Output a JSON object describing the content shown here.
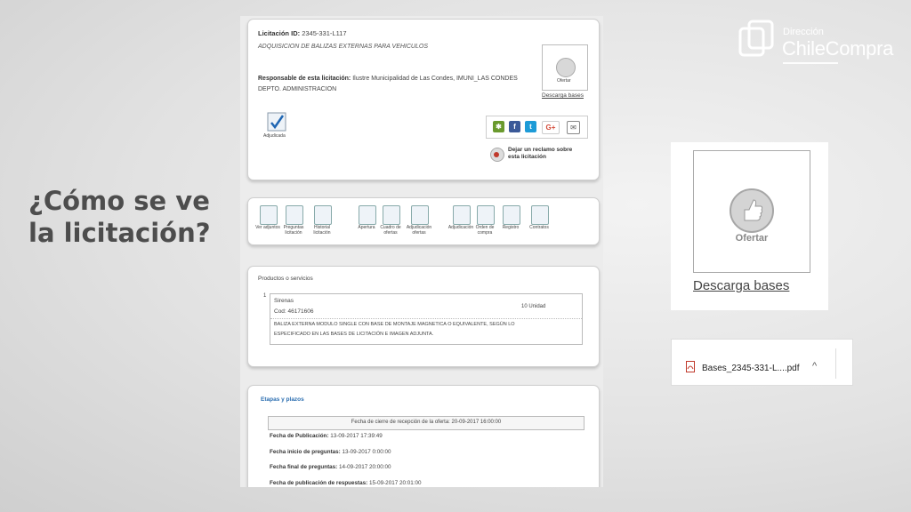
{
  "slide": {
    "title_line1": "¿Cómo se ve",
    "title_line2": "la licitación?"
  },
  "logo": {
    "direccion": "Dirección",
    "name": "ChileCompra"
  },
  "licitacion": {
    "id_label": "Licitación",
    "id_prefix": "ID:",
    "id_value": "2345-331-L117",
    "description": "ADQUISICION DE BALIZAS EXTERNAS PARA VEHICULOS",
    "responsable_label": "Responsable de esta licitación:",
    "responsable_value": "Ilustre Municipalidad de Las Condes, IMUNI_LAS CONDES",
    "depto": "DEPTO. ADMINISTRACION",
    "status_label": "Adjudicada",
    "ofertar_small_label": "Ofertar",
    "descarga_bases_small": "Descarga bases",
    "social": [
      "share",
      "f",
      "t",
      "G+",
      "mail"
    ],
    "reclamo_line1": "Dejar un reclamo sobre",
    "reclamo_line2": "esta licitación"
  },
  "actions": [
    {
      "icon": "ver-adjuntos-icon",
      "label": "Ver adjuntos"
    },
    {
      "icon": "preguntas-icon",
      "label": "Preguntas licitación"
    },
    {
      "icon": "historial-icon",
      "label": "Historial licitación"
    },
    {
      "icon": "apertura-icon",
      "label": "Apertura"
    },
    {
      "icon": "cuadro-ofertas-icon",
      "label": "Cuadro de ofertas"
    },
    {
      "icon": "adjudicacion-ofertas-icon",
      "label": "Adjudicación ofertas"
    },
    {
      "icon": "adjudicacion-icon",
      "label": "Adjudicación"
    },
    {
      "icon": "orden-compra-icon",
      "label": "Orden de compra"
    },
    {
      "icon": "registro-icon",
      "label": "Registro"
    },
    {
      "icon": "contratos-icon",
      "label": "Contratos"
    }
  ],
  "productos": {
    "heading": "Productos o servicios",
    "item_number": "1",
    "name": "Sirenas",
    "code": "Cod: 46171606",
    "quantity": "10 Unidad",
    "desc_line1": "BALIZA EXTERNA MODULO SINGLE CON BASE DE MONTAJE MAGNETICA O EQUIVALENTE, SEGÚN LO",
    "desc_line2": "ESPECIFICADO EN LAS BASES DE LICITACIÓN E IMAGEN ADJUNTA."
  },
  "etapas": {
    "heading": "Etapas y plazos",
    "cierre": "Fecha de cierre de recepción de la oferta: 20-09-2017 16:00:00",
    "rows": [
      {
        "label": "Fecha de Publicación:",
        "value": "13-09-2017 17:39:49"
      },
      {
        "label": "Fecha inicio de preguntas:",
        "value": "13-09-2017 0:00:00"
      },
      {
        "label": "Fecha final de preguntas:",
        "value": "14-09-2017 20:00:00"
      },
      {
        "label": "Fecha de publicación de respuestas:",
        "value": "15-09-2017 20:01:00"
      }
    ]
  },
  "zoom": {
    "ofertar_label": "Ofertar",
    "descarga_bases": "Descarga bases"
  },
  "download": {
    "filename": "Bases_2345-331-L....pdf",
    "caret": "^"
  },
  "colors": {
    "adjudicada_check": "#1f66b3",
    "link_blue": "#2a6db0",
    "reclamo_red": "#c0392b"
  }
}
